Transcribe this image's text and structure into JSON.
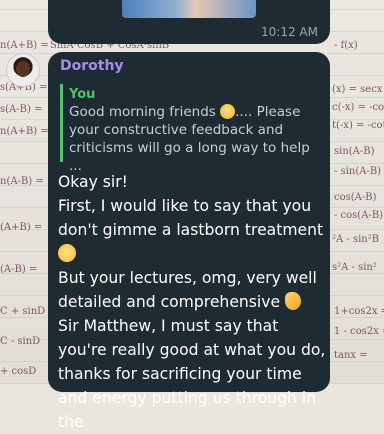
{
  "top_message": {
    "time": "10:12 AM"
  },
  "message": {
    "sender": "Dorothy",
    "reply": {
      "author": "You",
      "text_before_emoji": "Good morning friends ",
      "text_after_emoji": ".... Please your constructive feedback and criticisms will go a long way to help ..."
    },
    "lines": [
      "Okay sir!",
      "First, I would like to say that you don't gimme a lastborn treatment ",
      "But your lectures, omg, very well detailed and comprehensive ",
      "Sir Matthew, I must say that you're really good at what you do, thanks for sacrificing your time and energy putting us through in the"
    ],
    "emojis": [
      "wink-emoji",
      "smile-emoji",
      "ok-hand-emoji"
    ]
  },
  "background_formulas": {
    "left": [
      "n(A+B) =",
      "s(A+B) =",
      "s(A-B) =",
      "n(A+B) =",
      "n(A-B) =",
      "(A+B) =",
      "(A-B) =",
      "C + sinD",
      "C - sinD",
      "+ cosD"
    ],
    "right": [
      "(x) = secx",
      "c(-x) = -cosx",
      "t(-x) = -cot",
      "sin(A-B)",
      "- sin(A-B)",
      "cos(A-B)",
      "- cos(A-B)",
      "²A - sin²B",
      "s²A - sin²",
      "1+cos2x =",
      "1 - cos2x =",
      "tanx ="
    ],
    "top": [
      "SinA·CosB + CosA·sinB",
      "- f(x)"
    ]
  }
}
